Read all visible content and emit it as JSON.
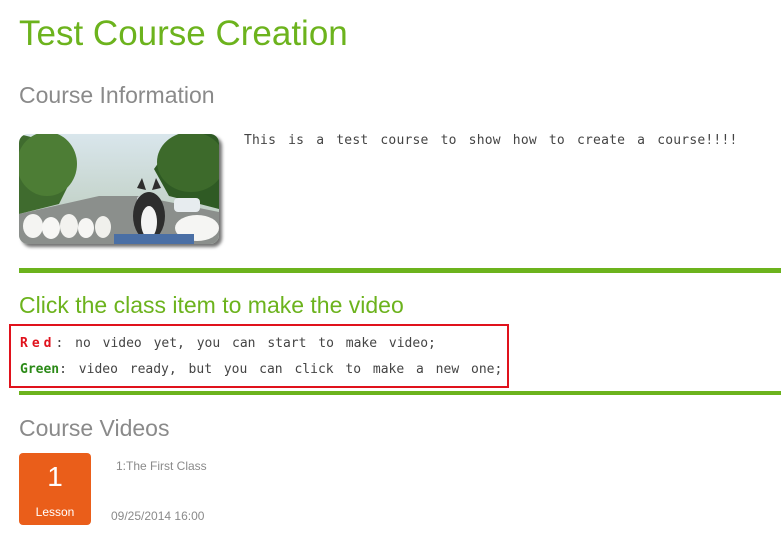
{
  "page": {
    "title": "Test Course Creation"
  },
  "course_info": {
    "heading": "Course Information",
    "image_alt": "huskies and samoyed dogs photo",
    "description": "This is a test course to show how to create a course!!!!"
  },
  "instructions": {
    "title": "Click the class item to make the video",
    "red_key": "Red",
    "red_text": ": no video yet, you can start to make video;",
    "green_key": "Green",
    "green_text": ": video ready, but you can click to make a new one;"
  },
  "videos": {
    "heading": "Course Videos",
    "items": [
      {
        "number": "1",
        "badge_label": "Lesson",
        "title": "1:The First Class",
        "timestamp": "09/25/2014 16:00"
      }
    ]
  },
  "colors": {
    "accent_green": "#6cb31d",
    "heading_gray": "#8a8a8a",
    "legend_border": "#e0121c",
    "badge_orange": "#ea5e1a",
    "key_red": "#e0121c",
    "key_green": "#2b8a17"
  }
}
